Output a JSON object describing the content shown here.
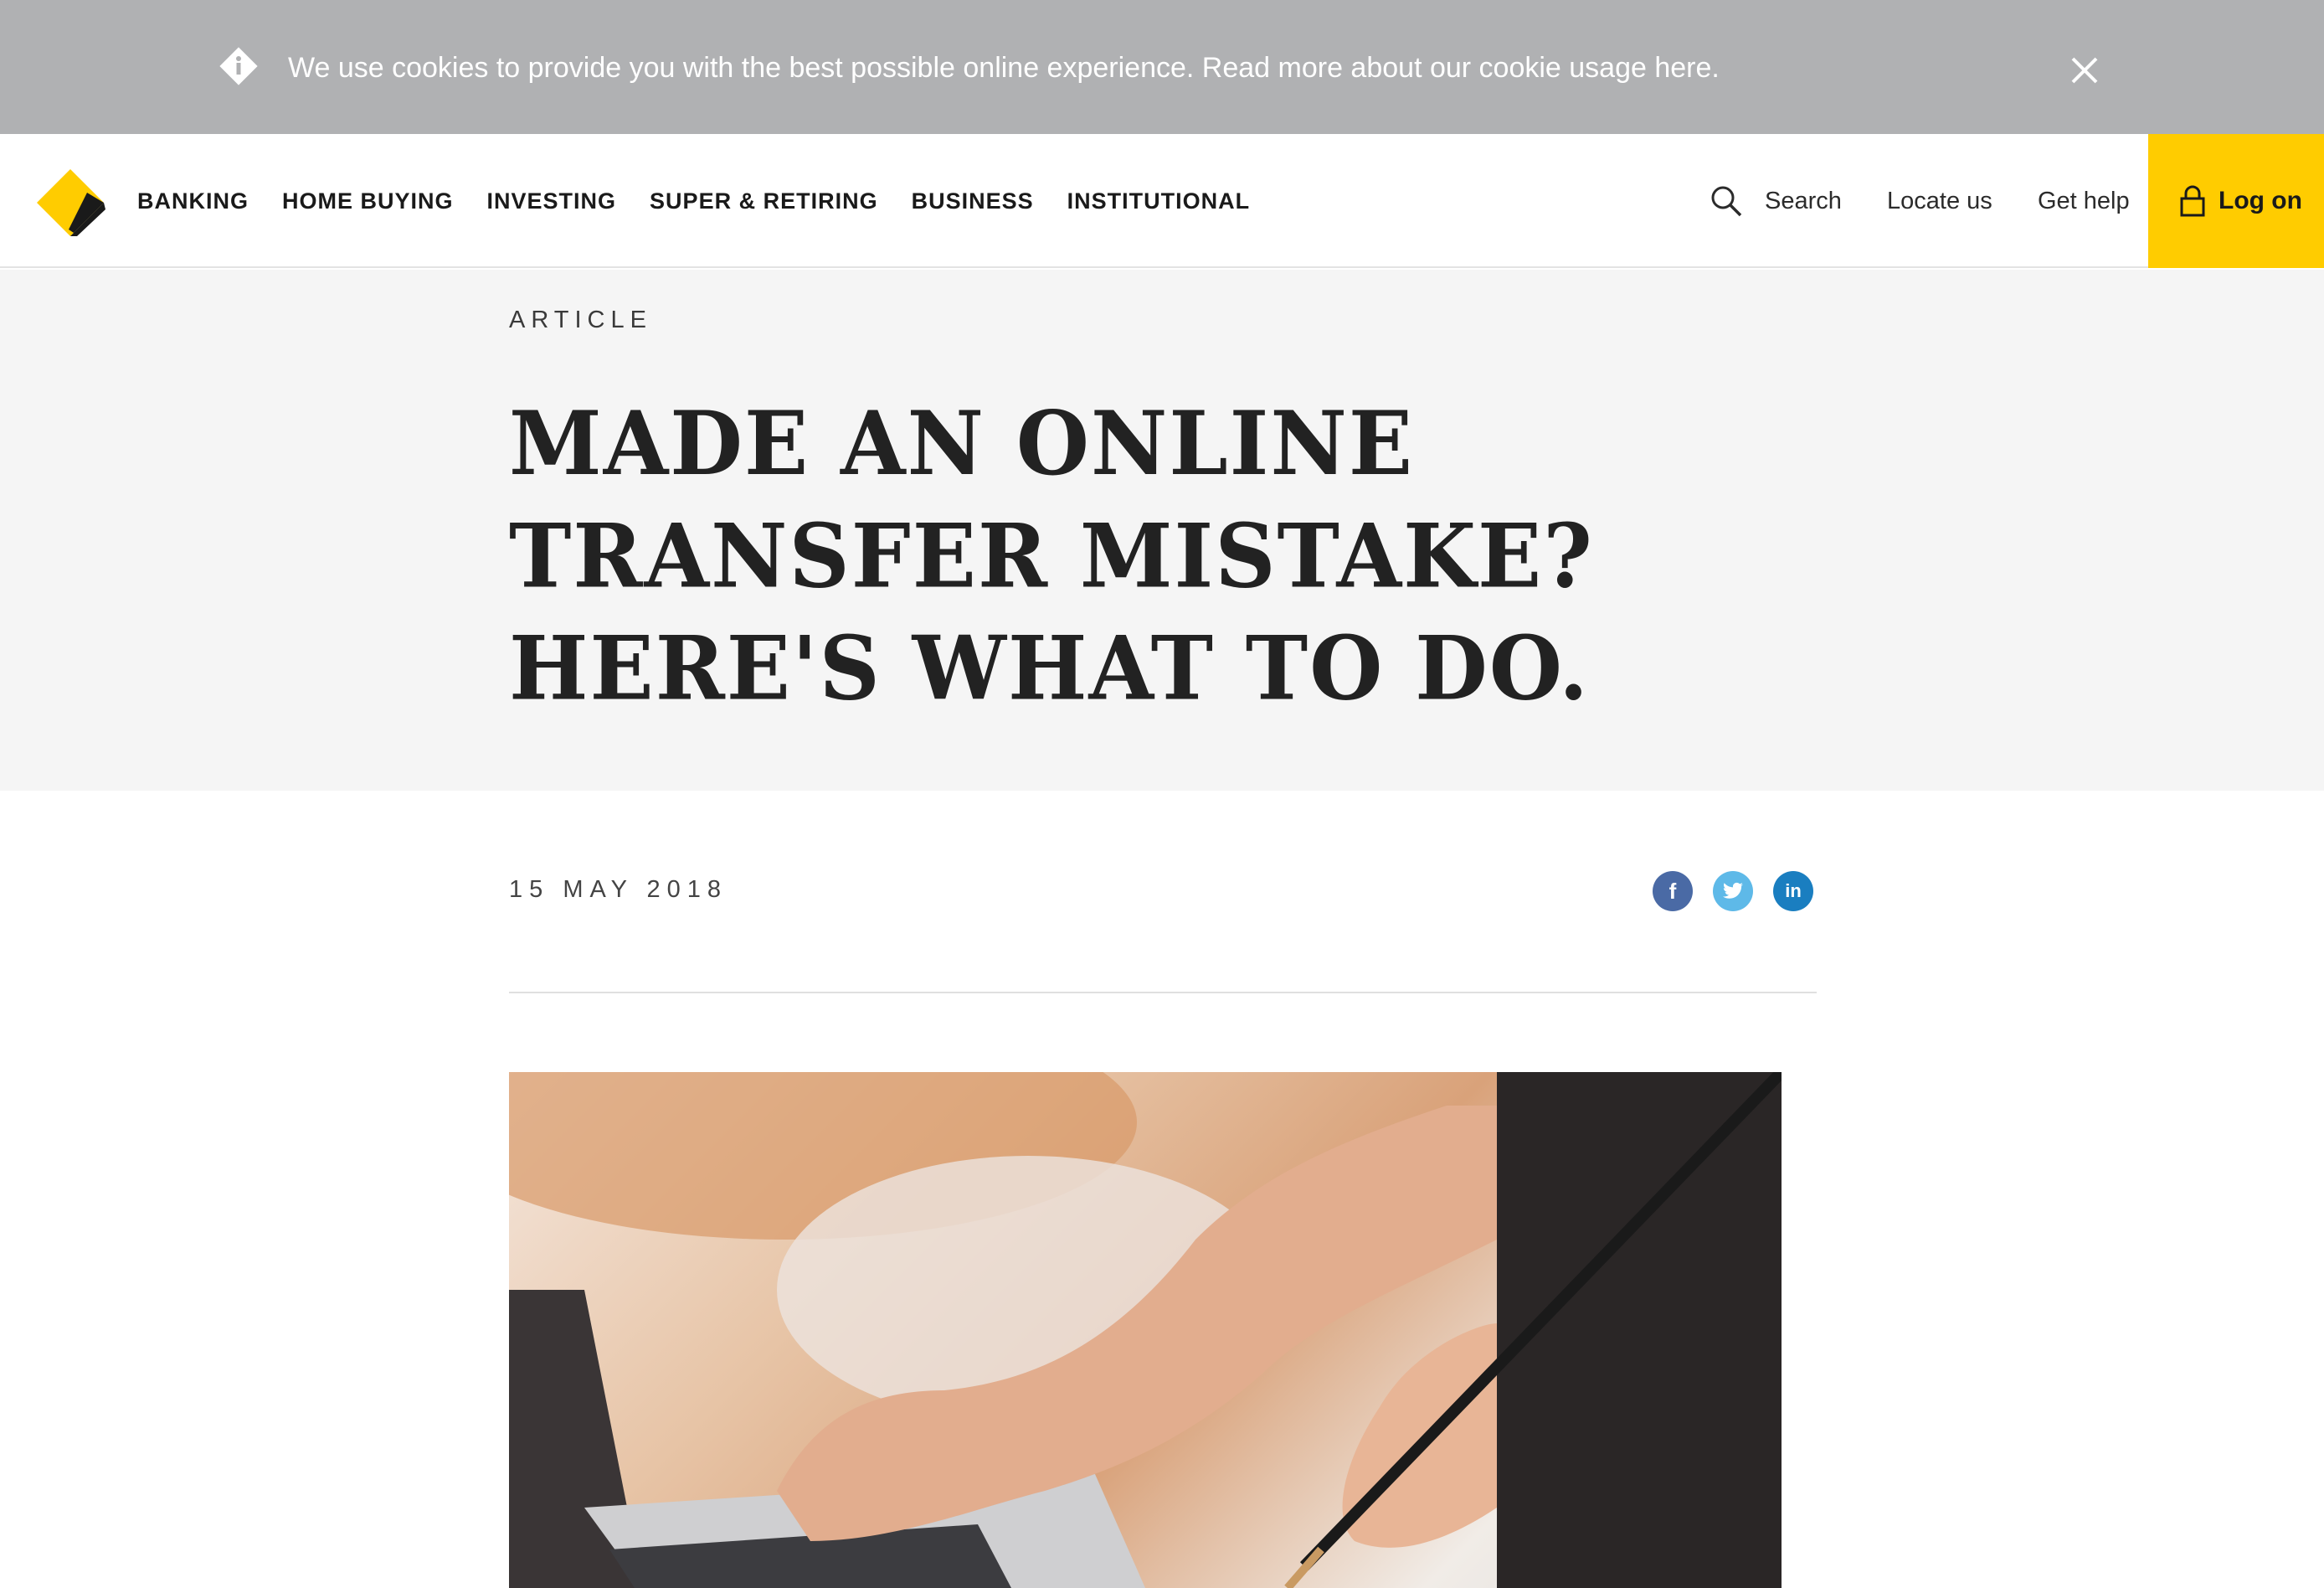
{
  "cookie": {
    "text": "We use cookies to provide you with the best possible online experience.",
    "link": "Read more about our cookie usage here",
    "period": "."
  },
  "nav": {
    "items": [
      "BANKING",
      "HOME BUYING",
      "INVESTING",
      "SUPER & RETIRING",
      "BUSINESS",
      "INSTITUTIONAL"
    ]
  },
  "utility": {
    "search": "Search",
    "locate": "Locate us",
    "help": "Get help",
    "logon": "Log on"
  },
  "article": {
    "kicker": "ARTICLE",
    "headline": "MADE AN ONLINE TRANSFER MISTAKE? HERE'S WHAT TO DO.",
    "date": "15 MAY 2018"
  },
  "share": {
    "facebook_glyph": "f",
    "linkedin_glyph": "in"
  },
  "colors": {
    "brand_yellow": "#ffcc00",
    "cookie_bg": "#b0b1b3",
    "hero_bg": "#f5f5f5",
    "facebook": "#4a6aa5",
    "twitter": "#5eb9e8",
    "linkedin": "#1a7ec0"
  },
  "icons": [
    "info-icon",
    "close-icon",
    "brand-logo",
    "search-icon",
    "lock-icon",
    "facebook-icon",
    "twitter-icon",
    "linkedin-icon"
  ]
}
